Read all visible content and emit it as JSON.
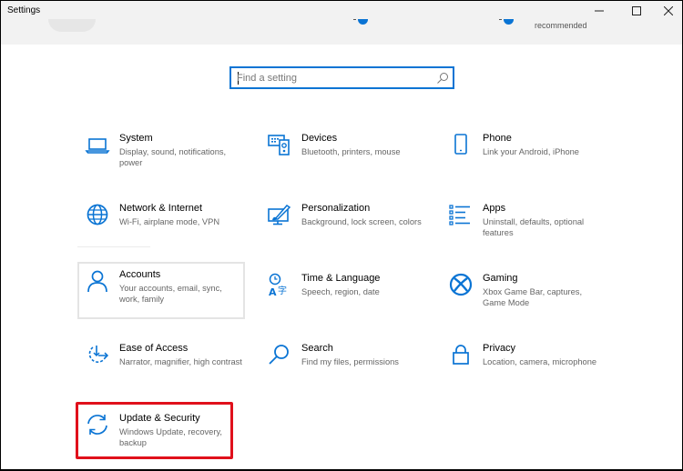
{
  "window": {
    "title": "Settings",
    "controls": {
      "minimize": "—",
      "maximize": "☐",
      "close": "✕"
    }
  },
  "header": {
    "recommended_text": "recommended"
  },
  "search": {
    "placeholder": "Find a setting",
    "value": "",
    "icon": "search-icon"
  },
  "accent_color": "#0a74d4",
  "highlight_color": "#e0101b",
  "categories": [
    {
      "name": "System",
      "description": "Display, sound, notifications, power",
      "icon": "laptop-icon"
    },
    {
      "name": "Devices",
      "description": "Bluetooth, printers, mouse",
      "icon": "devices-icon"
    },
    {
      "name": "Phone",
      "description": "Link your Android, iPhone",
      "icon": "phone-icon"
    },
    {
      "name": "Network & Internet",
      "description": "Wi-Fi, airplane mode, VPN",
      "icon": "globe-icon"
    },
    {
      "name": "Personalization",
      "description": "Background, lock screen, colors",
      "icon": "paintbrush-icon"
    },
    {
      "name": "Apps",
      "description": "Uninstall, defaults, optional features",
      "icon": "apps-list-icon"
    },
    {
      "name": "Accounts",
      "description": "Your accounts, email, sync, work, family",
      "icon": "person-icon"
    },
    {
      "name": "Time & Language",
      "description": "Speech, region, date",
      "icon": "time-language-icon"
    },
    {
      "name": "Gaming",
      "description": "Xbox Game Bar, captures, Game Mode",
      "icon": "xbox-icon"
    },
    {
      "name": "Ease of Access",
      "description": "Narrator, magnifier, high contrast",
      "icon": "ease-of-access-icon"
    },
    {
      "name": "Search",
      "description": "Find my files, permissions",
      "icon": "magnifier-icon"
    },
    {
      "name": "Privacy",
      "description": "Location, camera, microphone",
      "icon": "lock-icon"
    },
    {
      "name": "Update & Security",
      "description": "Windows Update, recovery, backup",
      "icon": "sync-arrows-icon"
    }
  ]
}
